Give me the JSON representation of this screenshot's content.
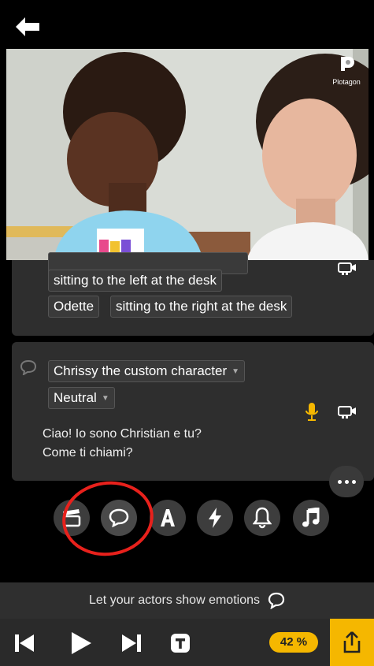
{
  "video": {
    "brand": "Plotagon"
  },
  "scene_card": {
    "items": [
      {
        "label": "sitting to the left at the desk"
      },
      {
        "label": "Odette"
      },
      {
        "label": "sitting to the right at the desk"
      }
    ]
  },
  "dialogue_card": {
    "character": "Chrissy the custom character",
    "emotion": "Neutral",
    "line1": "Ciao! Io sono Christian e tu?",
    "line2": "Come ti chiami?"
  },
  "toolbar": {
    "tools": [
      "clapperboard-icon",
      "speech-bubble-icon",
      "text-icon",
      "lightning-icon",
      "bell-icon",
      "music-note-icon"
    ],
    "selected": "speech-bubble-icon"
  },
  "hint": {
    "text": "Let your actors show emotions"
  },
  "bottom": {
    "zoom": "42 %"
  },
  "colors": {
    "accent": "#f5b700",
    "highlight": "#e8211c",
    "card": "#2e2e2e"
  }
}
